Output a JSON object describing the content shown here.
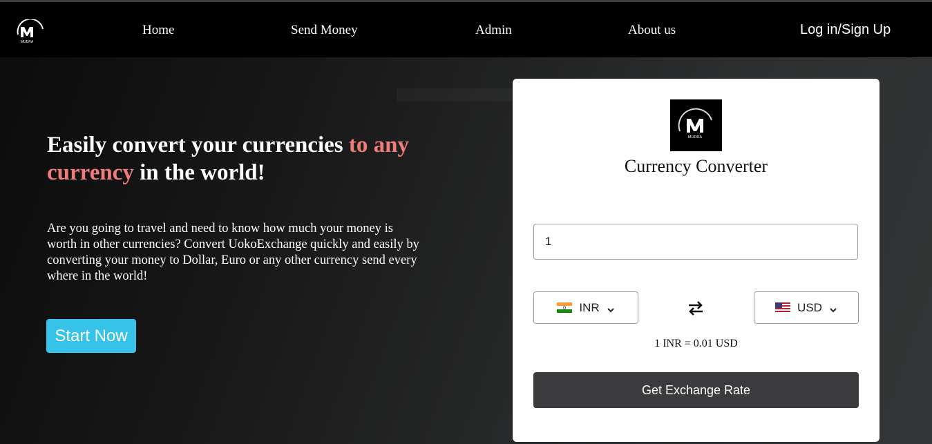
{
  "nav": {
    "logo_text": "MUDRA",
    "links": [
      {
        "label": "Home"
      },
      {
        "label": "Send Money"
      },
      {
        "label": "Admin"
      },
      {
        "label": "About us"
      }
    ],
    "login_label": "Log in/Sign Up"
  },
  "hero": {
    "title_part1": "Easily convert your currencies ",
    "title_accent": "to any currency",
    "title_part2": " in the world!",
    "description": "Are you going to travel and need to know how much your money is worth in other currencies? Convert UokoExchange quickly and easily by converting your money to Dollar, Euro or any other currency send every where in the world!",
    "start_label": "Start Now"
  },
  "converter": {
    "logo_text": "MUDRA",
    "title": "Currency Converter",
    "amount_value": "1",
    "from_currency": "INR",
    "to_currency": "USD",
    "from_flag": "india-flag",
    "to_flag": "us-flag",
    "rate_text": "1 INR = 0.01 USD",
    "button_label": "Get Exchange Rate"
  },
  "colors": {
    "accent_text": "#f07b7b",
    "start_button": "#35c3ea",
    "get_button": "#3b3b3d",
    "navbar": "#000000"
  }
}
